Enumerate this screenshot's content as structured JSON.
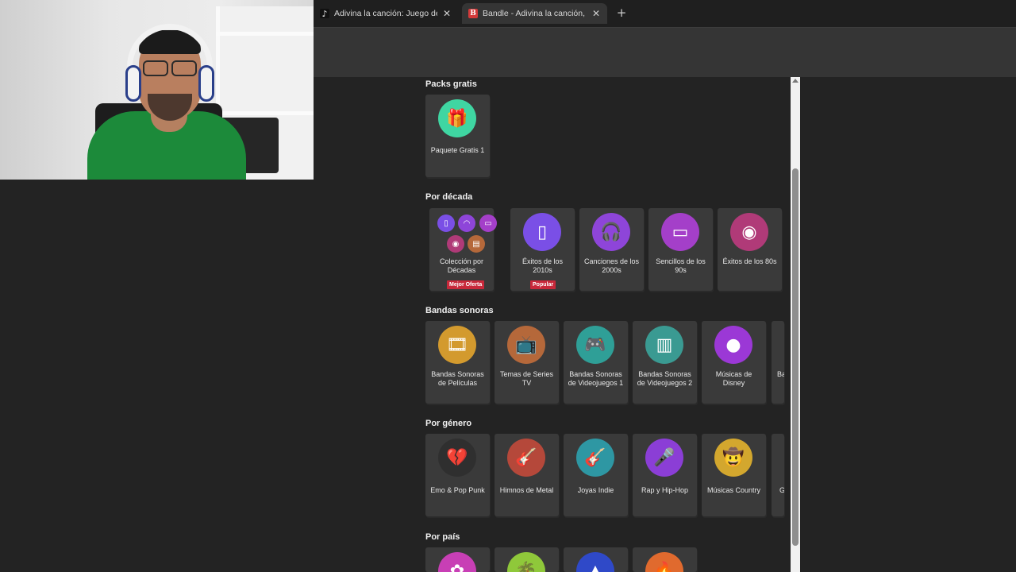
{
  "browser": {
    "tabs": [
      {
        "title": "Adivina la canción: Juego de im",
        "favicon": "tiktok-icon",
        "active": false
      },
      {
        "title": "Bandle - Adivina la canción, un",
        "favicon": "bandle-icon",
        "favicon_letter": "B",
        "active": true
      }
    ],
    "new_tab_label": "+",
    "close_glyph": "✕"
  },
  "sections": [
    {
      "title": "Packs gratis",
      "cards": [
        {
          "label": "Paquete Gratis 1",
          "icon": "gift-icon",
          "glyph": "🎁",
          "color": "#3fd6a2"
        }
      ]
    },
    {
      "title": "Por década",
      "cards": [
        {
          "label": "Colección por Décadas",
          "icon": "collection-icon",
          "badge": "Mejor Oferta"
        },
        {
          "label": "Éxitos de los 2010s",
          "icon": "smartphone-icon",
          "glyph": "▯",
          "color": "#7a4fe6",
          "badge": "Popular"
        },
        {
          "label": "Canciones de los 2000s",
          "icon": "headphones-icon",
          "glyph": "🎧",
          "color": "#8e45d9"
        },
        {
          "label": "Sencillos de los 90s",
          "icon": "cassette-icon",
          "glyph": "▭",
          "color": "#a43fc9"
        },
        {
          "label": "Éxitos de los 80s",
          "icon": "vinyl-icon",
          "glyph": "◉",
          "color": "#b03a78"
        }
      ]
    },
    {
      "title": "Bandas sonoras",
      "cards": [
        {
          "label": "Bandas Sonoras de Películas",
          "icon": "film-strip-icon",
          "glyph": "🎞",
          "color": "#d39a2e"
        },
        {
          "label": "Temas de Series TV",
          "icon": "tv-icon",
          "glyph": "📺",
          "color": "#b5683a"
        },
        {
          "label": "Bandas Sonoras de Videojuegos 1",
          "icon": "gamepad-icon",
          "glyph": "🎮",
          "color": "#2f9f97"
        },
        {
          "label": "Bandas Sonoras de Videojuegos 2",
          "icon": "handheld-console-icon",
          "glyph": "▥",
          "color": "#3a9a92"
        },
        {
          "label": "Músicas de Disney",
          "icon": "mouse-ears-icon",
          "glyph": "●",
          "color": "#9b38d6"
        },
        {
          "label": "Ba",
          "icon": "",
          "partial": true
        }
      ]
    },
    {
      "title": "Por género",
      "cards": [
        {
          "label": "Emo & Pop Punk",
          "icon": "broken-heart-icon",
          "glyph": "💔",
          "color": "#2f2f2f"
        },
        {
          "label": "Himnos de Metal",
          "icon": "electric-guitar-icon",
          "glyph": "🎸",
          "color": "#b5483a"
        },
        {
          "label": "Joyas Indie",
          "icon": "acoustic-guitar-icon",
          "glyph": "🎸",
          "color": "#2e97a3"
        },
        {
          "label": "Rap y Hip-Hop",
          "icon": "microphone-icon",
          "glyph": "🎤",
          "color": "#8b3ed6"
        },
        {
          "label": "Músicas Country",
          "icon": "cowboy-hat-icon",
          "glyph": "🤠",
          "color": "#d3a72e"
        },
        {
          "label": "G",
          "icon": "",
          "partial": true
        }
      ]
    },
    {
      "title": "Por país",
      "cards": [
        {
          "label": "",
          "icon": "country-pink-icon",
          "glyph": "✿",
          "color": "#c83fb5"
        },
        {
          "label": "",
          "icon": "palm-tree-icon",
          "glyph": "🌴",
          "color": "#8fc83a"
        },
        {
          "label": "",
          "icon": "tower-icon",
          "glyph": "▲",
          "color": "#2f49c8"
        },
        {
          "label": "",
          "icon": "flame-icon",
          "glyph": "🔥",
          "color": "#e06a2e"
        }
      ]
    }
  ],
  "collection_mini_icons": [
    {
      "icon": "smartphone-icon",
      "color": "#7a4fe6",
      "glyph": "▯"
    },
    {
      "icon": "headphones-icon",
      "color": "#8e45d9",
      "glyph": "◠"
    },
    {
      "icon": "cassette-icon",
      "color": "#a43fc9",
      "glyph": "▭"
    },
    {
      "icon": "vinyl-icon",
      "color": "#b03a78",
      "glyph": "◉"
    },
    {
      "icon": "radio-icon",
      "color": "#b5683a",
      "glyph": "▤"
    }
  ]
}
